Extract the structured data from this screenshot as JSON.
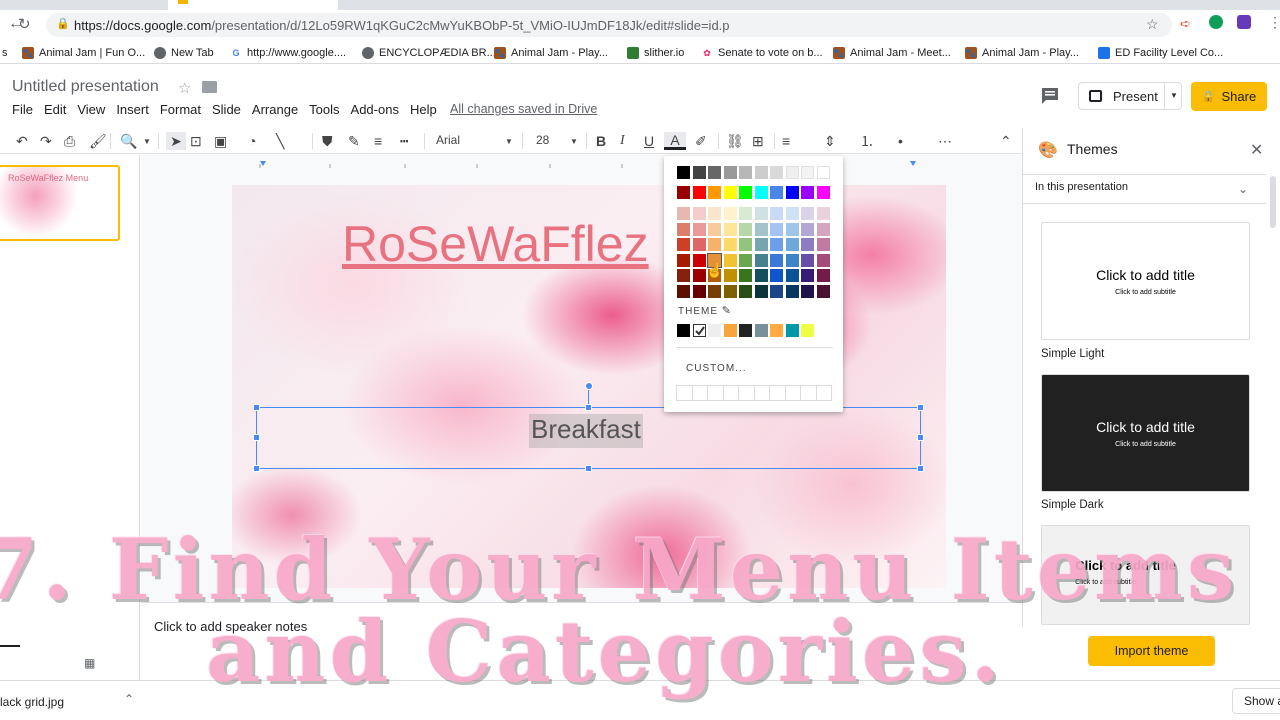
{
  "browser": {
    "url_main": "https://docs.google.com",
    "url_path": "/presentation/d/12Lo59RW1qKGuC2cMwYuKBObP-5t_VMiO-IUJmDF18Jk/edit#slide=id.p",
    "bookmarks": [
      {
        "label": "Animal Jam | Fun O...",
        "icon": "paw-icon"
      },
      {
        "label": "New Tab",
        "icon": "globe-icon"
      },
      {
        "label": "http://www.google....",
        "icon": "google-icon"
      },
      {
        "label": "ENCYCLOPÆDIA BR...",
        "icon": "globe-icon"
      },
      {
        "label": "Animal Jam - Play...",
        "icon": "paw-icon"
      },
      {
        "label": "slither.io",
        "icon": "snake-icon"
      },
      {
        "label": "Senate to vote on b...",
        "icon": "nbc-icon"
      },
      {
        "label": "Animal Jam - Meet...",
        "icon": "paw-icon"
      },
      {
        "label": "Animal Jam - Play...",
        "icon": "paw-icon"
      },
      {
        "label": "ED Facility Level Co...",
        "icon": "grid-icon"
      }
    ]
  },
  "doc": {
    "title": "Untitled presentation",
    "menu": [
      "File",
      "Edit",
      "View",
      "Insert",
      "Format",
      "Slide",
      "Arrange",
      "Tools",
      "Add-ons",
      "Help"
    ],
    "saved_status": "All changes saved in Drive",
    "present_label": "Present",
    "share_label": "Share"
  },
  "toolbar": {
    "font": "Arial",
    "font_size": "28"
  },
  "slide": {
    "title": "RoSeWaFflez",
    "thumb_title": "RoSeWaFflez Menu",
    "body_text": "Breakfast",
    "notes_placeholder": "Click to add speaker notes"
  },
  "color_popup": {
    "theme_label": "THEME",
    "custom_label": "CUSTOM...",
    "grays": [
      "#000000",
      "#434343",
      "#666666",
      "#999999",
      "#b7b7b7",
      "#cccccc",
      "#d9d9d9",
      "#efefef",
      "#f3f3f3",
      "#ffffff"
    ],
    "brights": [
      "#980000",
      "#ff0000",
      "#ff9900",
      "#ffff00",
      "#00ff00",
      "#00ffff",
      "#4a86e8",
      "#0000ff",
      "#9900ff",
      "#ff00ff"
    ],
    "tints": [
      [
        "#e6b8af",
        "#f4cccc",
        "#fce5cd",
        "#fff2cc",
        "#d9ead3",
        "#d0e0e3",
        "#c9daf8",
        "#cfe2f3",
        "#d9d2e9",
        "#ead1dc"
      ],
      [
        "#dd7e6b",
        "#ea9999",
        "#f9cb9c",
        "#ffe599",
        "#b6d7a8",
        "#a2c4c9",
        "#a4c2f4",
        "#9fc5e8",
        "#b4a7d6",
        "#d5a6bd"
      ],
      [
        "#cc4125",
        "#e06666",
        "#f6b26b",
        "#ffd966",
        "#93c47d",
        "#76a5af",
        "#6d9eeb",
        "#6fa8dc",
        "#8e7cc3",
        "#c27ba0"
      ],
      [
        "#a61c00",
        "#cc0000",
        "#e69138",
        "#f1c232",
        "#6aa84f",
        "#45818e",
        "#3c78d8",
        "#3d85c6",
        "#674ea7",
        "#a64d79"
      ],
      [
        "#85200c",
        "#990000",
        "#b45f06",
        "#bf9000",
        "#38761d",
        "#134f5c",
        "#1155cc",
        "#0b5394",
        "#351c75",
        "#741b47"
      ],
      [
        "#5b0f00",
        "#660000",
        "#783f04",
        "#7f6000",
        "#274e13",
        "#0c343d",
        "#1c4587",
        "#073763",
        "#20124d",
        "#4c1130"
      ]
    ],
    "theme_colors": [
      "#000000",
      "#ffffff",
      "#eeeeee",
      "#f6a63c",
      "#212121",
      "#78909c",
      "#ffab40",
      "#0097a7",
      "#eeff41"
    ]
  },
  "themes": {
    "title": "Themes",
    "filter": "In this presentation",
    "cards": [
      {
        "name": "Simple Light",
        "title": "Click to add title",
        "subtitle": "Click to add subtitle",
        "bg": "#ffffff",
        "fg": "#000000"
      },
      {
        "name": "Simple Dark",
        "title": "Click to add title",
        "subtitle": "Click to add subtitle",
        "bg": "#212121",
        "fg": "#ffffff"
      },
      {
        "name": "",
        "title": "Click to add title",
        "subtitle": "Click to add subtitle",
        "bg": "#f1f1f1",
        "fg": "#000000"
      }
    ],
    "import_label": "Import theme"
  },
  "download": {
    "filename": "lack grid.jpg",
    "show_all": "Show all"
  },
  "overlay": {
    "line1": "7. Find Your Menu Items",
    "line2": "and Categories."
  }
}
